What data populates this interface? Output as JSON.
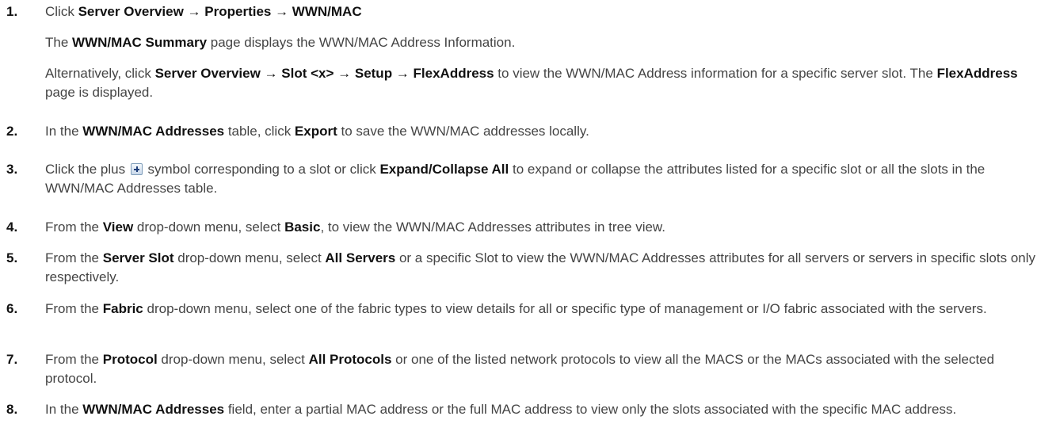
{
  "steps": [
    {
      "num": "1.",
      "parts": [
        {
          "t": "Click "
        },
        {
          "t": "Server Overview → Properties → WWN/MAC",
          "b": true
        }
      ]
    },
    {
      "num": "",
      "parts": [
        {
          "t": "The "
        },
        {
          "t": "WWN/MAC Summary",
          "b": true
        },
        {
          "t": " page displays the WWN/MAC Address Information."
        }
      ]
    },
    {
      "num": "",
      "parts": [
        {
          "t": "Alternatively, click "
        },
        {
          "t": "Server Overview → Slot <x> → Setup → FlexAddress",
          "b": true
        },
        {
          "t": " to view the WWN/MAC Address information for a specific server slot. The "
        },
        {
          "t": "FlexAddress",
          "b": true
        },
        {
          "t": " page is displayed."
        }
      ]
    },
    {
      "num": "2.",
      "parts": [
        {
          "t": "In the "
        },
        {
          "t": "WWN/MAC Addresses",
          "b": true
        },
        {
          "t": " table, click "
        },
        {
          "t": "Export",
          "b": true
        },
        {
          "t": " to save the WWN/MAC addresses locally."
        }
      ]
    },
    {
      "num": "3.",
      "parts": [
        {
          "t": "Click the plus "
        },
        {
          "icon": "plus-icon"
        },
        {
          "t": " symbol corresponding to a slot or click "
        },
        {
          "t": "Expand/Collapse All",
          "b": true
        },
        {
          "t": " to expand or collapse the attributes listed for a specific slot or all the slots in the WWN/MAC Addresses table."
        }
      ]
    },
    {
      "num": "4.",
      "parts": [
        {
          "t": "From the "
        },
        {
          "t": "View",
          "b": true
        },
        {
          "t": " drop-down menu, select "
        },
        {
          "t": "Basic",
          "b": true
        },
        {
          "t": ", to view the WWN/MAC Addresses attributes in tree view."
        }
      ]
    },
    {
      "num": "5.",
      "parts": [
        {
          "t": "From the "
        },
        {
          "t": "Server Slot",
          "b": true
        },
        {
          "t": " drop-down menu, select "
        },
        {
          "t": "All Servers",
          "b": true
        },
        {
          "t": " or a specific Slot to view the WWN/MAC Addresses attributes for all servers or servers in specific slots only respectively."
        }
      ]
    },
    {
      "num": "6.",
      "parts": [
        {
          "t": "From the "
        },
        {
          "t": "Fabric",
          "b": true
        },
        {
          "t": " drop-down menu, select one of the fabric types to view details for all or specific type of management or I/O fabric associated with the servers."
        }
      ]
    },
    {
      "num": "7.",
      "parts": [
        {
          "t": "From the "
        },
        {
          "t": "Protocol",
          "b": true
        },
        {
          "t": " drop-down menu, select "
        },
        {
          "t": "All Protocols",
          "b": true
        },
        {
          "t": " or one of the listed network protocols to view all the MACS or the MACs associated with the selected protocol."
        }
      ]
    },
    {
      "num": "8.",
      "parts": [
        {
          "t": "In the "
        },
        {
          "t": "WWN/MAC Addresses",
          "b": true
        },
        {
          "t": " field, enter a partial MAC address or the full MAC address to view only the slots associated with the specific MAC address."
        }
      ]
    }
  ]
}
